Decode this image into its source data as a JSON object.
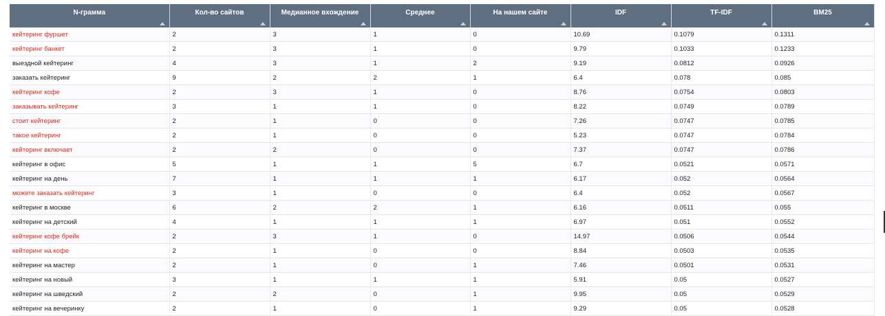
{
  "table": {
    "columns": [
      "N-грамма",
      "Кол-во сайтов",
      "Медианное вхождение",
      "Среднее",
      "На нашем сайте",
      "IDF",
      "TF-IDF",
      "BM25"
    ],
    "rows": [
      {
        "c": [
          "кейтеринг фуршет",
          "2",
          "3",
          "1",
          "0",
          "10.69",
          "0.1079",
          "0.1311"
        ],
        "red": true
      },
      {
        "c": [
          "кейтеринг банкет",
          "2",
          "3",
          "1",
          "0",
          "9.79",
          "0.1033",
          "0.1233"
        ],
        "red": true
      },
      {
        "c": [
          "выездной кейтеринг",
          "4",
          "3",
          "1",
          "2",
          "9.19",
          "0.0812",
          "0.0926"
        ],
        "red": false
      },
      {
        "c": [
          "заказать кейтеринг",
          "9",
          "2",
          "2",
          "1",
          "6.4",
          "0.078",
          "0.085"
        ],
        "red": false
      },
      {
        "c": [
          "кейтеринг кофе",
          "2",
          "3",
          "1",
          "0",
          "8.76",
          "0.0754",
          "0.0803"
        ],
        "red": true
      },
      {
        "c": [
          "заказывать кейтеринг",
          "3",
          "1",
          "1",
          "0",
          "8.22",
          "0.0749",
          "0.0789"
        ],
        "red": true
      },
      {
        "c": [
          "стоит кейтеринг",
          "2",
          "1",
          "0",
          "0",
          "7.26",
          "0.0747",
          "0.0785"
        ],
        "red": true
      },
      {
        "c": [
          "такое кейтеринг",
          "2",
          "1",
          "0",
          "0",
          "5.23",
          "0.0747",
          "0.0784"
        ],
        "red": true
      },
      {
        "c": [
          "кейтеринг включает",
          "2",
          "2",
          "0",
          "0",
          "7.37",
          "0.0747",
          "0.0786"
        ],
        "red": true
      },
      {
        "c": [
          "кейтеринг в офис",
          "5",
          "1",
          "1",
          "5",
          "6.7",
          "0.0521",
          "0.0571"
        ],
        "red": false
      },
      {
        "c": [
          "кейтеринг на день",
          "7",
          "1",
          "1",
          "1",
          "6.17",
          "0.052",
          "0.0564"
        ],
        "red": false
      },
      {
        "c": [
          "можете заказать кейтеринг",
          "3",
          "1",
          "0",
          "0",
          "6.4",
          "0.052",
          "0.0567"
        ],
        "red": true
      },
      {
        "c": [
          "кейтеринг в москве",
          "6",
          "2",
          "2",
          "1",
          "6.16",
          "0.0511",
          "0.055"
        ],
        "red": false
      },
      {
        "c": [
          "кейтеринг на детский",
          "4",
          "1",
          "1",
          "1",
          "6.97",
          "0.051",
          "0.0552"
        ],
        "red": false
      },
      {
        "c": [
          "кейтеринг кофе брейк",
          "2",
          "3",
          "1",
          "0",
          "14.97",
          "0.0506",
          "0.0544"
        ],
        "red": true
      },
      {
        "c": [
          "кейтеринг на кофе",
          "2",
          "1",
          "0",
          "0",
          "8.84",
          "0.0503",
          "0.0535"
        ],
        "red": true
      },
      {
        "c": [
          "кейтеринг на мастер",
          "2",
          "1",
          "0",
          "1",
          "7.46",
          "0.0501",
          "0.0531"
        ],
        "red": false
      },
      {
        "c": [
          "кейтеринг на новый",
          "3",
          "1",
          "1",
          "1",
          "5.91",
          "0.05",
          "0.0527"
        ],
        "red": false
      },
      {
        "c": [
          "кейтеринг на шведский",
          "2",
          "2",
          "0",
          "1",
          "9.95",
          "0.05",
          "0.0529"
        ],
        "red": false
      },
      {
        "c": [
          "кейтеринг на вечеринку",
          "2",
          "1",
          "0",
          "1",
          "9.29",
          "0.05",
          "0.0528"
        ],
        "red": false
      }
    ]
  },
  "colors": {
    "header_bg": "#5f6f82",
    "missing_term": "#e0281e",
    "text": "#222222"
  },
  "icons": {
    "sort": "sort-arrow-icon"
  }
}
